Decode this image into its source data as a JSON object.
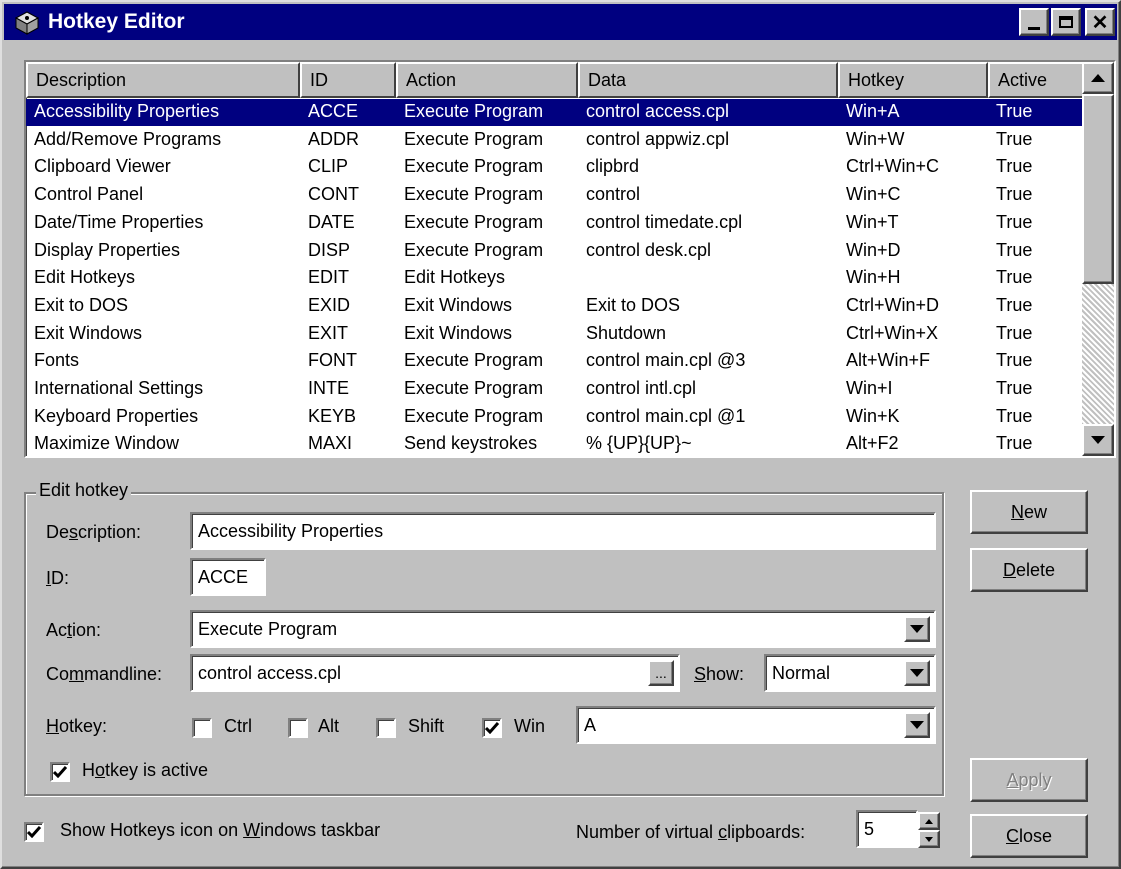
{
  "window": {
    "title": "Hotkey Editor"
  },
  "columns": [
    "Description",
    "ID",
    "Action",
    "Data",
    "Hotkey",
    "Active"
  ],
  "rows": [
    {
      "description": "Accessibility Properties",
      "id": "ACCE",
      "action": "Execute Program",
      "data": "control access.cpl",
      "hotkey": "Win+A",
      "active": "True"
    },
    {
      "description": "Add/Remove Programs",
      "id": "ADDR",
      "action": "Execute Program",
      "data": "control appwiz.cpl",
      "hotkey": "Win+W",
      "active": "True"
    },
    {
      "description": "Clipboard Viewer",
      "id": "CLIP",
      "action": "Execute Program",
      "data": "clipbrd",
      "hotkey": "Ctrl+Win+C",
      "active": "True"
    },
    {
      "description": "Control Panel",
      "id": "CONT",
      "action": "Execute Program",
      "data": "control",
      "hotkey": "Win+C",
      "active": "True"
    },
    {
      "description": "Date/Time Properties",
      "id": "DATE",
      "action": "Execute Program",
      "data": "control timedate.cpl",
      "hotkey": "Win+T",
      "active": "True"
    },
    {
      "description": "Display Properties",
      "id": "DISP",
      "action": "Execute Program",
      "data": "control desk.cpl",
      "hotkey": "Win+D",
      "active": "True"
    },
    {
      "description": "Edit Hotkeys",
      "id": "EDIT",
      "action": "Edit Hotkeys",
      "data": "",
      "hotkey": "Win+H",
      "active": "True"
    },
    {
      "description": "Exit to DOS",
      "id": "EXID",
      "action": "Exit Windows",
      "data": "Exit to DOS",
      "hotkey": "Ctrl+Win+D",
      "active": "True"
    },
    {
      "description": "Exit Windows",
      "id": "EXIT",
      "action": "Exit Windows",
      "data": "Shutdown",
      "hotkey": "Ctrl+Win+X",
      "active": "True"
    },
    {
      "description": "Fonts",
      "id": "FONT",
      "action": "Execute Program",
      "data": "control main.cpl @3",
      "hotkey": "Alt+Win+F",
      "active": "True"
    },
    {
      "description": "International Settings",
      "id": "INTE",
      "action": "Execute Program",
      "data": "control intl.cpl",
      "hotkey": "Win+I",
      "active": "True"
    },
    {
      "description": "Keyboard Properties",
      "id": "KEYB",
      "action": "Execute Program",
      "data": "control main.cpl @1",
      "hotkey": "Win+K",
      "active": "True"
    },
    {
      "description": "Maximize Window",
      "id": "MAXI",
      "action": "Send keystrokes",
      "data": "% {UP}{UP}~",
      "hotkey": "Alt+F2",
      "active": "True"
    }
  ],
  "edit": {
    "group_title": "Edit hotkey",
    "description_label": "Description:",
    "description_value": "Accessibility Properties",
    "id_label": "ID:",
    "id_value": "ACCE",
    "action_label": "Action:",
    "action_value": "Execute Program",
    "commandline_label": "Commandline:",
    "commandline_value": "control access.cpl",
    "browse_label": "...",
    "show_label": "Show:",
    "show_value": "Normal",
    "hotkey_label": "Hotkey:",
    "ctrl_label": "Ctrl",
    "ctrl_checked": false,
    "alt_label": "Alt",
    "alt_checked": false,
    "shift_label": "Shift",
    "shift_checked": false,
    "win_label": "Win",
    "win_checked": true,
    "key_value": "A",
    "active_label": "Hotkey is active",
    "active_checked": true
  },
  "buttons": {
    "new": "New",
    "delete": "Delete",
    "apply": "Apply",
    "close": "Close"
  },
  "footer": {
    "taskbar_label": "Show Hotkeys icon on Windows taskbar",
    "taskbar_checked": true,
    "clipboards_label": "Number of virtual clipboards:",
    "clipboards_value": "5"
  }
}
